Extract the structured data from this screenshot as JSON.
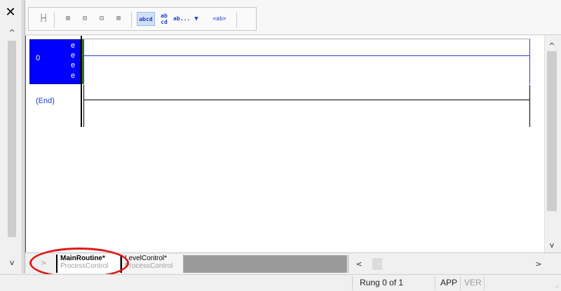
{
  "window": {
    "close_label": "✕"
  },
  "toolbar": {
    "buttons": [
      {
        "id": "branch",
        "label": "├┤"
      },
      {
        "id": "add-rung-above",
        "label": "⊞"
      },
      {
        "id": "add-rung-below",
        "label": "⊟"
      },
      {
        "id": "move-in",
        "label": "⊡"
      },
      {
        "id": "move-out",
        "label": "⊠"
      },
      {
        "id": "abcd",
        "label": "abcd"
      },
      {
        "id": "ab-cd",
        "label": "ab cd"
      },
      {
        "id": "ab-more",
        "label": "ab..."
      },
      {
        "id": "dropdown",
        "label": "▼"
      },
      {
        "id": "ab-tag",
        "label": "<ab>"
      }
    ]
  },
  "ladder": {
    "rung_number": "0",
    "rung_markers": [
      "e",
      "e",
      "e",
      "e"
    ],
    "end_label": "(End)"
  },
  "tabs": [
    {
      "name": "MainRoutine*",
      "program": "ProcessControl",
      "active": true
    },
    {
      "name": "LevelControl*",
      "program": "ProcessControl",
      "active": false
    }
  ],
  "tab_nav": ">",
  "scroll": {
    "up": "^",
    "down": "v",
    "left": "<",
    "right": ">"
  },
  "status": {
    "rung": "Rung 0 of 1",
    "app": "APP",
    "ver": "VER",
    "grip": ".:"
  }
}
